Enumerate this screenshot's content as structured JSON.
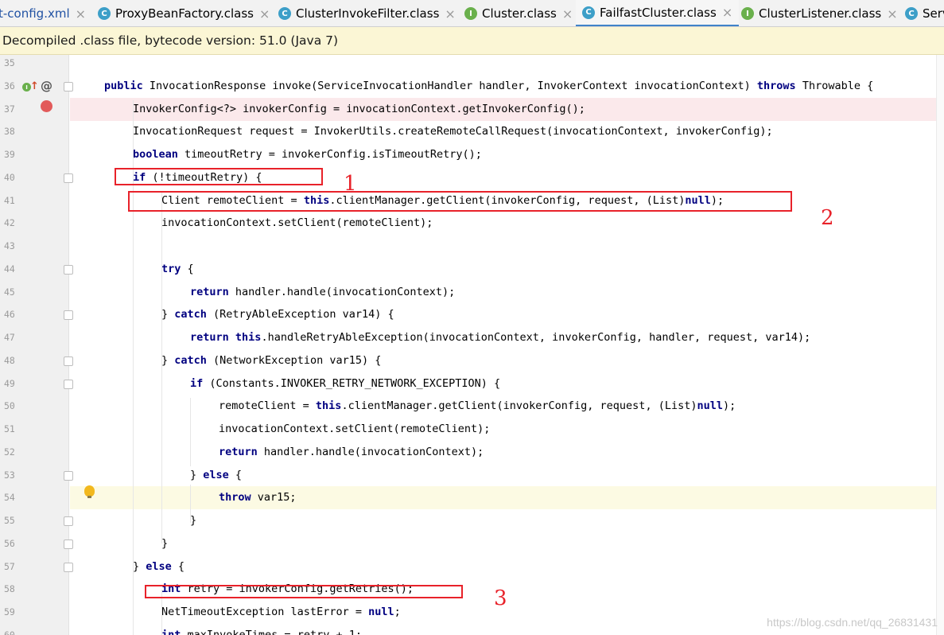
{
  "tabs": [
    {
      "label": "t-config.xml",
      "icon": "none",
      "close": "×"
    },
    {
      "label": "ProxyBeanFactory.class",
      "icon": "C",
      "close": "×"
    },
    {
      "label": "ClusterInvokeFilter.class",
      "icon": "C",
      "close": "×"
    },
    {
      "label": "Cluster.class",
      "icon": "I",
      "close": "×"
    },
    {
      "label": "FailfastCluster.class",
      "icon": "C",
      "close": "×",
      "active": true
    },
    {
      "label": "ClusterListener.class",
      "icon": "I",
      "close": "×"
    },
    {
      "label": "Serv",
      "icon": "C",
      "close": ""
    }
  ],
  "banner": {
    "text": "Decompiled .class file, bytecode version: 51.0 (Java 7)"
  },
  "editor": {
    "lines": [
      {
        "num": "35",
        "tokens": []
      },
      {
        "num": "36",
        "tokens": [
          [
            "kw",
            "public"
          ],
          [
            "t",
            " InvocationResponse invoke(ServiceInvocationHandler handler, InvokerContext invocationContext) "
          ],
          [
            "kw",
            "throws"
          ],
          [
            "t",
            " Throwable {"
          ]
        ]
      },
      {
        "num": "37",
        "tokens": [
          [
            "t",
            "InvokerConfig<?> invokerConfig = invocationContext.getInvokerConfig();"
          ]
        ]
      },
      {
        "num": "38",
        "tokens": [
          [
            "t",
            "InvocationRequest request = InvokerUtils.createRemoteCallRequest(invocationContext, invokerConfig);"
          ]
        ]
      },
      {
        "num": "39",
        "tokens": [
          [
            "kw",
            "boolean"
          ],
          [
            "t",
            " timeoutRetry = invokerConfig.isTimeoutRetry();"
          ]
        ]
      },
      {
        "num": "40",
        "tokens": [
          [
            "kw",
            "if"
          ],
          [
            "t",
            " (!timeoutRetry) {"
          ]
        ]
      },
      {
        "num": "41",
        "tokens": [
          [
            "t",
            "Client remoteClient = "
          ],
          [
            "kw",
            "this"
          ],
          [
            "t",
            ".clientManager.getClient(invokerConfig, request, (List)"
          ],
          [
            "kw",
            "null"
          ],
          [
            "t",
            ");"
          ]
        ]
      },
      {
        "num": "42",
        "tokens": [
          [
            "t",
            "invocationContext.setClient(remoteClient);"
          ]
        ]
      },
      {
        "num": "43",
        "tokens": []
      },
      {
        "num": "44",
        "tokens": [
          [
            "kw",
            "try"
          ],
          [
            "t",
            " {"
          ]
        ]
      },
      {
        "num": "45",
        "tokens": [
          [
            "kw",
            "return"
          ],
          [
            "t",
            " handler.handle(invocationContext);"
          ]
        ]
      },
      {
        "num": "46",
        "tokens": [
          [
            "t",
            "} "
          ],
          [
            "kw",
            "catch"
          ],
          [
            "t",
            " (RetryAbleException var14) {"
          ]
        ]
      },
      {
        "num": "47",
        "tokens": [
          [
            "kw",
            "return"
          ],
          [
            "t",
            " "
          ],
          [
            "kw",
            "this"
          ],
          [
            "t",
            ".handleRetryAbleException(invocationContext, invokerConfig, handler, request, var14);"
          ]
        ]
      },
      {
        "num": "48",
        "tokens": [
          [
            "t",
            "} "
          ],
          [
            "kw",
            "catch"
          ],
          [
            "t",
            " (NetworkException var15) {"
          ]
        ]
      },
      {
        "num": "49",
        "tokens": [
          [
            "kw",
            "if"
          ],
          [
            "t",
            " (Constants.INVOKER_RETRY_NETWORK_EXCEPTION) {"
          ]
        ]
      },
      {
        "num": "50",
        "tokens": [
          [
            "t",
            "remoteClient = "
          ],
          [
            "kw",
            "this"
          ],
          [
            "t",
            ".clientManager.getClient(invokerConfig, request, (List)"
          ],
          [
            "kw",
            "null"
          ],
          [
            "t",
            ");"
          ]
        ]
      },
      {
        "num": "51",
        "tokens": [
          [
            "t",
            "invocationContext.setClient(remoteClient);"
          ]
        ]
      },
      {
        "num": "52",
        "tokens": [
          [
            "kw",
            "return"
          ],
          [
            "t",
            " handler.handle(invocationContext);"
          ]
        ]
      },
      {
        "num": "53",
        "tokens": [
          [
            "t",
            "} "
          ],
          [
            "kw",
            "else"
          ],
          [
            "t",
            " {"
          ]
        ]
      },
      {
        "num": "54",
        "tokens": [
          [
            "kw",
            "throw"
          ],
          [
            "t",
            " var15;"
          ]
        ]
      },
      {
        "num": "55",
        "tokens": [
          [
            "t",
            "}"
          ]
        ]
      },
      {
        "num": "56",
        "tokens": [
          [
            "t",
            "}"
          ]
        ]
      },
      {
        "num": "57",
        "tokens": [
          [
            "t",
            "} "
          ],
          [
            "kw",
            "else"
          ],
          [
            "t",
            " {"
          ]
        ]
      },
      {
        "num": "58",
        "tokens": [
          [
            "kw",
            "int"
          ],
          [
            "t",
            " retry = invokerConfig.getRetries();"
          ]
        ]
      },
      {
        "num": "59",
        "tokens": [
          [
            "t",
            "NetTimeoutException lastError = "
          ],
          [
            "kw",
            "null"
          ],
          [
            "t",
            ";"
          ]
        ]
      },
      {
        "num": "60",
        "tokens": [
          [
            "kw",
            "int"
          ],
          [
            "t",
            " maxInvokeTimes = retry + 1;"
          ]
        ]
      }
    ]
  },
  "annotations": [
    {
      "label": "1"
    },
    {
      "label": "2"
    },
    {
      "label": "3"
    }
  ],
  "watermark": "https://blog.csdn.net/qq_26831431",
  "colors": {
    "keyword": "#000080",
    "annotation": "#e8222a",
    "breakpoint_line": "#fbe9eb",
    "current_line": "#fcfae3",
    "banner": "#fbf6d5",
    "active_tab_underline": "#4083c9"
  },
  "icons": {
    "breakpoint": "red-circle",
    "implements": "green-I-badge",
    "override": "up-arrow",
    "annotation": "at-sign",
    "intention": "light-bulb"
  }
}
